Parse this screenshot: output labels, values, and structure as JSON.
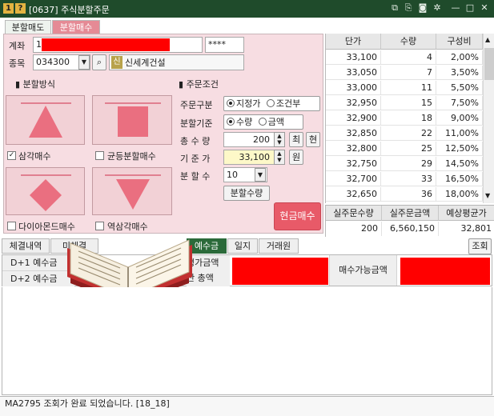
{
  "window": {
    "badge1": "1",
    "badge2": "?",
    "title": "[0637] 주식분할주문",
    "controls": [
      "restore-icon",
      "link-icon",
      "camera-icon",
      "settings-icon",
      "minimize-icon",
      "close-icon"
    ]
  },
  "tabs": [
    {
      "label": "분할매도",
      "active": false
    },
    {
      "label": "분할매수",
      "active": true
    }
  ],
  "form": {
    "account_label": "계좌",
    "account_value": "1",
    "password_value": "****",
    "stock_label": "종목",
    "stock_code": "034300",
    "credit_tag": "신",
    "stock_name": "신세계건설"
  },
  "split_method": {
    "header": "분할방식",
    "options": [
      {
        "label": "삼각매수",
        "checked": true
      },
      {
        "label": "균등분할매수",
        "checked": false
      },
      {
        "label": "다이아몬드매수",
        "checked": false
      },
      {
        "label": "역삼각매수",
        "checked": false
      }
    ]
  },
  "order_cond": {
    "header": "주문조건",
    "type_label": "주문구분",
    "type_options": [
      {
        "label": "지정가",
        "selected": true
      },
      {
        "label": "조건부",
        "selected": false
      }
    ],
    "basis_label": "분할기준",
    "basis_options": [
      {
        "label": "수량",
        "selected": true
      },
      {
        "label": "금액",
        "selected": false
      }
    ],
    "total_qty_label": "총 수 량",
    "total_qty": "200",
    "max_btn": "최",
    "cur_btn": "현",
    "base_price_label": "기 준 가",
    "base_price": "33,100",
    "won_btn": "원",
    "split_count_label": "분 할 수",
    "split_count": "10",
    "split_qty_btn": "분할수량",
    "buy_btn": "현금매수"
  },
  "grid": {
    "headers": [
      "단가",
      "수량",
      "구성비"
    ],
    "rows": [
      [
        "33,100",
        "4",
        "2,00%"
      ],
      [
        "33,050",
        "7",
        "3,50%"
      ],
      [
        "33,000",
        "11",
        "5,50%"
      ],
      [
        "32,950",
        "15",
        "7,50%"
      ],
      [
        "32,900",
        "18",
        "9,00%"
      ],
      [
        "32,850",
        "22",
        "11,00%"
      ],
      [
        "32,800",
        "25",
        "12,50%"
      ],
      [
        "32,750",
        "29",
        "14,50%"
      ],
      [
        "32,700",
        "33",
        "16,50%"
      ],
      [
        "32,650",
        "36",
        "18,00%"
      ]
    ]
  },
  "summary": {
    "headers": [
      "실주문수량",
      "실주문금액",
      "예상평균가"
    ],
    "values": [
      "200",
      "6,560,150",
      "32,801"
    ]
  },
  "bottom_tabs": [
    {
      "label": "체결내역",
      "active": false
    },
    {
      "label": "미체결",
      "active": false
    },
    {
      "label": "예수금",
      "active": true
    },
    {
      "label": "일지",
      "active": false
    },
    {
      "label": "거래원",
      "active": false
    }
  ],
  "query_btn": "조회",
  "deposit": {
    "d1_label": "D+1 예수금",
    "d2_label": "D+2 예수금",
    "eval_label": "평가금액",
    "total_label": "산 총액",
    "buyable_label": "매수가능금액"
  },
  "status": "MA2795 조회가 완료 되었습니다. [18_18]"
}
